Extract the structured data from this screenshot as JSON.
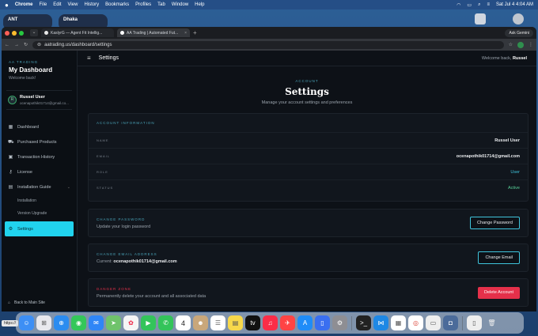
{
  "menubar": {
    "app": "Chrome",
    "items": [
      "File",
      "Edit",
      "View",
      "History",
      "Bookmarks",
      "Profiles",
      "Tab",
      "Window",
      "Help"
    ],
    "clock": "Sat Jul 4  4:04 AM"
  },
  "widgets": {
    "left": "ANT",
    "right": "Dhaka"
  },
  "browser": {
    "tabs": [
      {
        "label": "KaslyrG — Agent Fit Intellig..."
      },
      {
        "label": "AA Trading | Automated Fut..."
      }
    ],
    "new_tab": "+",
    "gemini_label": "Ask Gemini",
    "url": "aatrading.us/dashboard/settings",
    "status_url": "https://"
  },
  "sidebar": {
    "brand_small": "AA TRADING",
    "brand_title": "My Dashboard",
    "brand_sub": "Welcome back!",
    "user": {
      "initial": "R",
      "name": "Russel User",
      "email": "ocenapothik01714@gmail.co..."
    },
    "nav": {
      "dashboard": "Dashboard",
      "purchased": "Purchased Products",
      "transactions": "Transaction History",
      "license": "License",
      "guide": "Installation Guide",
      "installation": "Installation",
      "version_upgrade": "Version Upgrade",
      "settings": "Settings"
    },
    "back": "Back to Main Site"
  },
  "header": {
    "title": "Settings",
    "welcome_prefix": "Welcome back,",
    "welcome_name": "Russel"
  },
  "hero": {
    "eyebrow": "ACCOUNT",
    "title": "Settings",
    "subtitle": "Manage your account settings and preferences"
  },
  "account_info": {
    "label": "ACCOUNT INFORMATION",
    "rows": {
      "name_key": "NAME",
      "name_val": "Russel User",
      "email_key": "EMAIL",
      "email_val": "ocenapothik01714@gmail.com",
      "role_key": "ROLE",
      "role_val": "User",
      "status_key": "STATUS",
      "status_val": "Active"
    }
  },
  "change_password": {
    "label": "CHANGE PASSWORD",
    "desc": "Update your login password",
    "button": "Change Password"
  },
  "change_email": {
    "label": "CHANGE EMAIL ADDRESS",
    "desc_prefix": "Current:",
    "current": "ocenapothik01714@gmail.com",
    "button": "Change Email"
  },
  "danger_zone": {
    "label": "DANGER ZONE",
    "desc": "Permanently delete your account and all associated data",
    "button": "Delete Account"
  },
  "dock": {
    "icons": [
      "finder-icon",
      "launchpad-icon",
      "safari-icon",
      "messages-icon",
      "mail-icon",
      "maps-icon",
      "photos-icon",
      "facetime-icon",
      "phone-icon",
      "calendar-icon",
      "contacts-icon",
      "reminders-icon",
      "notes-icon",
      "tv-icon",
      "music-icon",
      "news-icon",
      "appstore-icon",
      "files-icon",
      "settings-icon",
      "terminal-icon",
      "vscode-icon",
      "sheets-icon",
      "chrome-icon",
      "preview-icon",
      "screenshot-icon",
      "downloads-icon",
      "trash-icon"
    ],
    "calendar_day": "4",
    "tv_label": "tv"
  }
}
